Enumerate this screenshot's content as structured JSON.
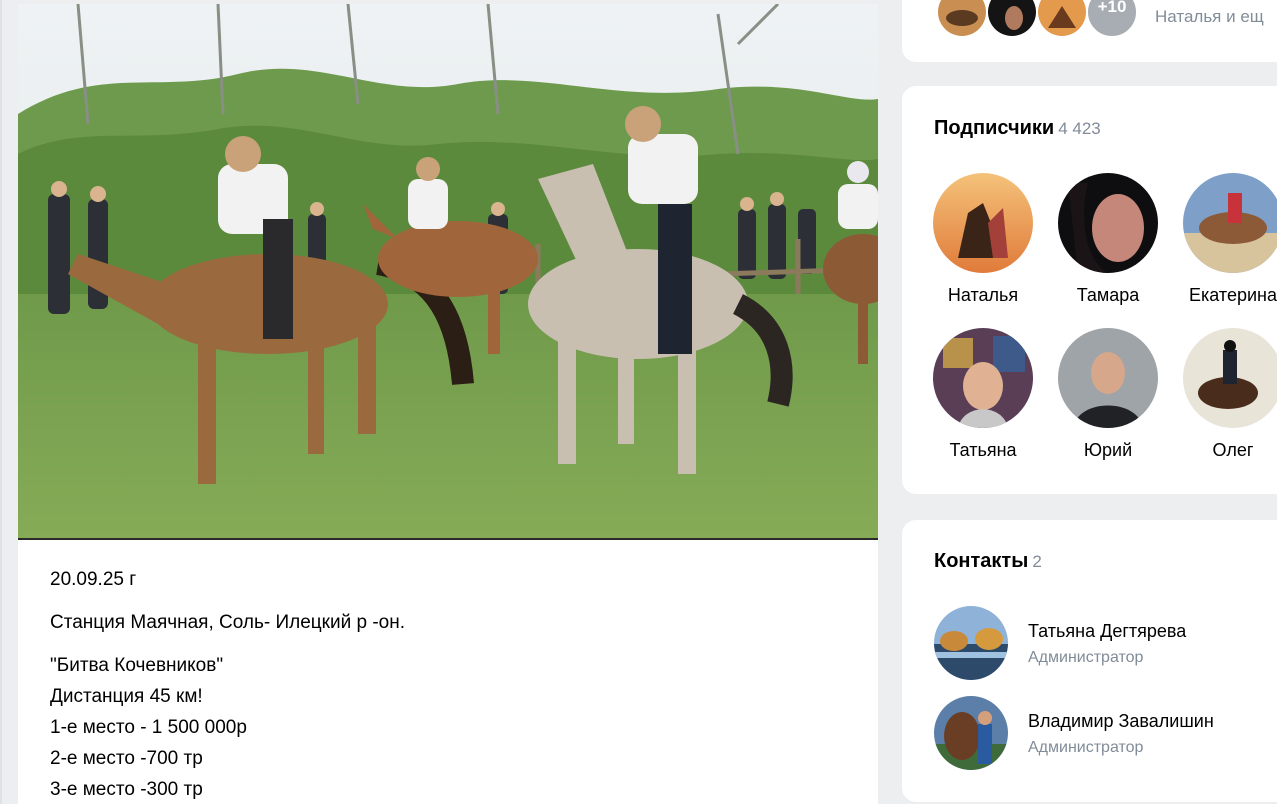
{
  "post": {
    "photo_icon": "horse-race-photo",
    "lines": [
      "20.09.25 г",
      "Станция Маячная, Соль- Илецкий р -он.",
      "\"Битва Кочевников\"",
      "Дистанция 45 км!",
      "1-е место - 1 500 000р",
      "2-е место -700 тр",
      "3-е место -300 тр"
    ]
  },
  "top_card": {
    "more_badge": "+10",
    "text": "Наталья и ещ"
  },
  "subscribers": {
    "title": "Подписчики",
    "count": "4 423",
    "items": [
      {
        "name": "Наталья"
      },
      {
        "name": "Тамара"
      },
      {
        "name": "Екатерина"
      },
      {
        "name": "Татьяна"
      },
      {
        "name": "Юрий"
      },
      {
        "name": "Олег"
      }
    ]
  },
  "contacts": {
    "title": "Контакты",
    "count": "2",
    "items": [
      {
        "name": "Татьяна Дегтярева",
        "role": "Администратор"
      },
      {
        "name": "Владимир Завалишин",
        "role": "Администратор"
      }
    ]
  },
  "colors": {
    "background": "#edeef0",
    "card": "#ffffff",
    "secondary_text": "#818c99"
  }
}
